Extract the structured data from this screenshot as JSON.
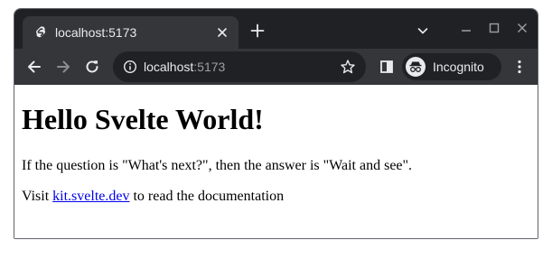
{
  "browser": {
    "tab": {
      "title": "localhost:5173",
      "favicon": "svelte-icon"
    },
    "new_tab_icon": "plus-icon",
    "tab_search_icon": "chevron-down-icon",
    "window_controls": [
      "minimize-icon",
      "maximize-icon",
      "close-icon"
    ],
    "nav": {
      "back_icon": "arrow-left-icon",
      "forward_icon": "arrow-right-icon",
      "reload_icon": "reload-icon"
    },
    "address": {
      "host": "localhost",
      "port": ":5173",
      "info_icon": "info-icon",
      "bookmark_icon": "star-icon"
    },
    "side_panel_icon": "side-panel-icon",
    "profile": {
      "label": "Incognito",
      "icon": "incognito-icon"
    },
    "menu_icon": "kebab-menu-icon",
    "colors": {
      "frame": "#202124",
      "toolbar": "#35363a",
      "text": "#e8eaed",
      "link": "#0000ee"
    }
  },
  "page": {
    "heading": "Hello Svelte World!",
    "paragraph": "If the question is \"What's next?\", then the answer is \"Wait and see\".",
    "docs": {
      "prefix": "Visit ",
      "link_text": "kit.svelte.dev",
      "suffix": " to read the documentation"
    }
  }
}
